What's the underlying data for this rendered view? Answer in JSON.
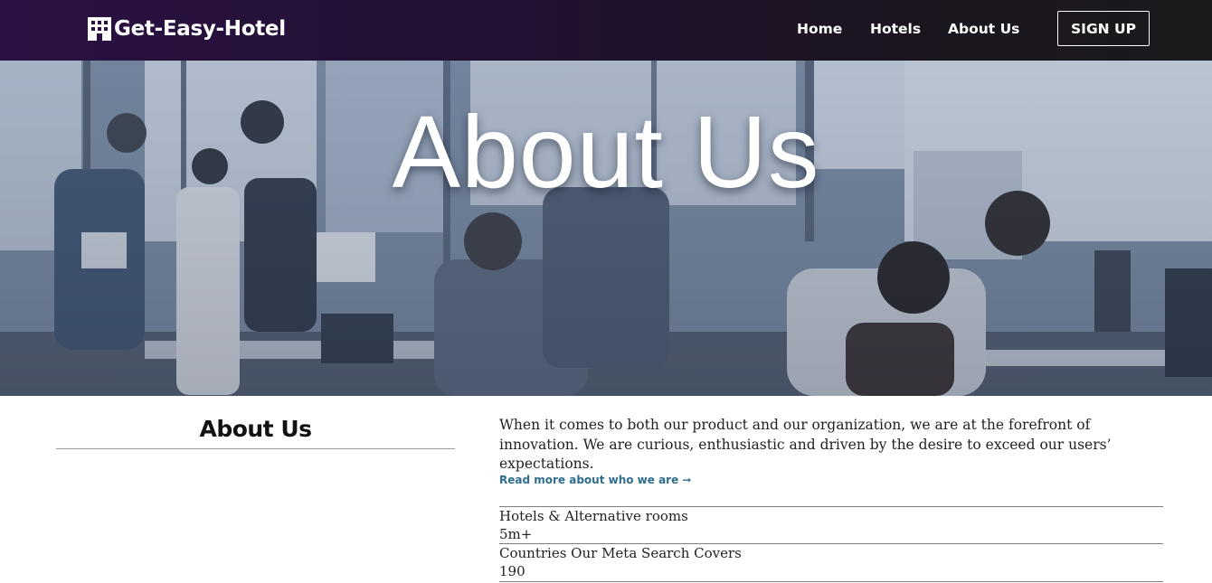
{
  "brand": {
    "name": "Get-Easy-Hotel",
    "icon": "hotel-building-icon"
  },
  "nav": {
    "links": [
      "Home",
      "Hotels",
      "About Us"
    ],
    "signup_label": "SIGN UP"
  },
  "hero": {
    "title": "About Us"
  },
  "about": {
    "heading": "About Us",
    "intro": "When it comes to both our product and our organization, we are at the forefront of innovation. We are curious, enthusiastic and driven by the desire to exceed our users’ expectations.",
    "read_more": "Read more about who we are ➞"
  },
  "stats": [
    {
      "label": "Hotels & Alternative rooms",
      "value": "5m+"
    },
    {
      "label": "Countries Our Meta Search Covers",
      "value": "190"
    }
  ],
  "colors": {
    "navbar": "#2a1144",
    "link_accent": "#2e6d8f",
    "text": "#222222"
  }
}
